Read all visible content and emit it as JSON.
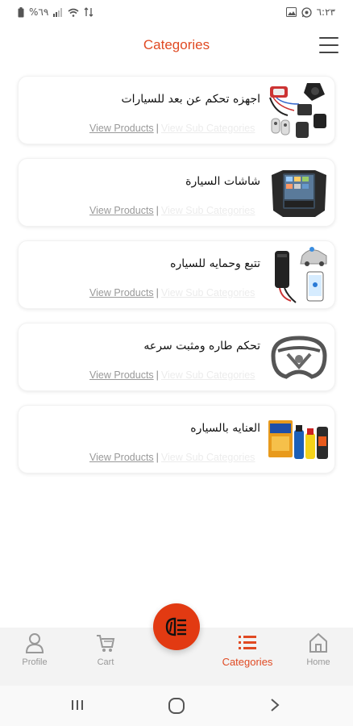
{
  "status_bar": {
    "battery_percent": "%٦٩",
    "time": "٦:٢٣"
  },
  "header": {
    "title": "Categories"
  },
  "categories": [
    {
      "name": "اجهزه تحكم عن بعد للسيارات",
      "view_products": "View Products",
      "separator": "|",
      "sub_categories": "View Sub Categories"
    },
    {
      "name": "شاشات السيارة",
      "view_products": "View Products",
      "separator": "|",
      "sub_categories": "View Sub Categories"
    },
    {
      "name": "تتبع وحمايه للسياره",
      "view_products": "View Products",
      "separator": "|",
      "sub_categories": "View Sub Categories"
    },
    {
      "name": "تحكم طاره ومثبت سرعه",
      "view_products": "View Products",
      "separator": "|",
      "sub_categories": "View Sub Categories"
    },
    {
      "name": "العنايه بالسياره",
      "view_products": "View Products",
      "separator": "|",
      "sub_categories": "View Sub Categories"
    }
  ],
  "bottom_nav": {
    "profile": "Profile",
    "cart": "Cart",
    "categories": "Categories",
    "home": "Home"
  },
  "colors": {
    "accent": "#e04a23",
    "fab": "#e23a12"
  }
}
